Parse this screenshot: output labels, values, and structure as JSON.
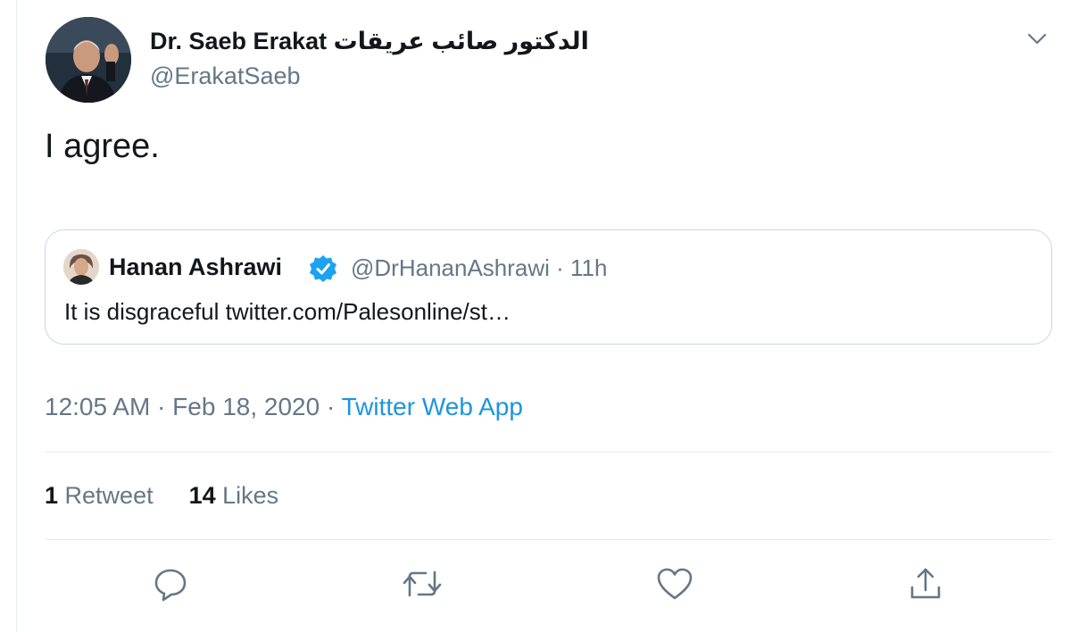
{
  "tweet": {
    "display_name": "Dr. Saeb Erakat الدكتور صائب عريقات",
    "handle": "@ErakatSaeb",
    "avatar_icon": "profile-photo",
    "text": "I agree.",
    "timestamp": "12:05 AM · Feb 18, 2020 · ",
    "source": "Twitter Web App"
  },
  "quote": {
    "name": "Hanan Ashrawi",
    "verified_icon": "verified-badge-icon",
    "handle_time": "@DrHananAshrawi · 11h",
    "text": "It is disgraceful twitter.com/Palesonline/st…"
  },
  "stats": {
    "retweets_count": "1",
    "retweets_label": " Retweet",
    "likes_count": "14",
    "likes_label": " Likes"
  },
  "actions": [
    "reply-icon",
    "retweet-icon",
    "like-icon",
    "share-icon"
  ],
  "colors": {
    "accent": "#1b95e0",
    "verified": "#1da1f2",
    "secondary_text": "#657786",
    "border": "#e6ecf0"
  }
}
